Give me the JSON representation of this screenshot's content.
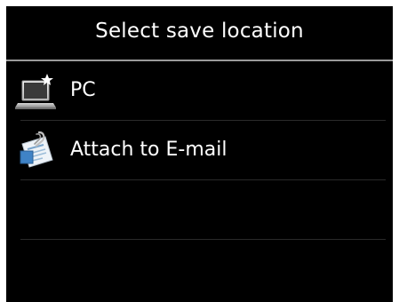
{
  "header": {
    "title": "Select save location"
  },
  "items": [
    {
      "label": "PC",
      "icon": "laptop-icon"
    },
    {
      "label": "Attach to E-mail",
      "icon": "email-attachment-icon"
    }
  ]
}
